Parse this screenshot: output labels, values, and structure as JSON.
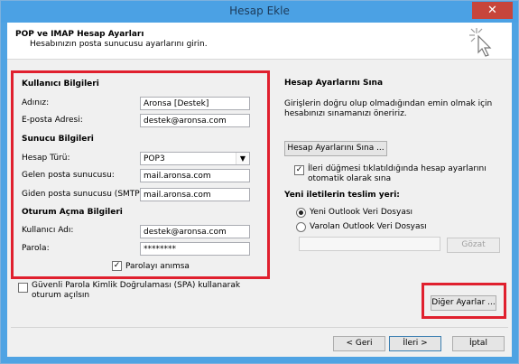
{
  "window": {
    "title": "Hesap Ekle",
    "close_label": "✕"
  },
  "header": {
    "title": "POP ve IMAP Hesap Ayarları",
    "subtitle": "Hesabınızın posta sunucusu ayarlarını girin."
  },
  "user_info": {
    "section": "Kullanıcı Bilgileri",
    "name_label": "Adınız:",
    "name_value": "Aronsa [Destek]",
    "email_label": "E-posta Adresi:",
    "email_value": "destek@aronsa.com"
  },
  "server_info": {
    "section": "Sunucu Bilgileri",
    "type_label": "Hesap Türü:",
    "type_value": "POP3",
    "incoming_label": "Gelen posta sunucusu:",
    "incoming_value": "mail.aronsa.com",
    "outgoing_label": "Giden posta sunucusu (SMTP):",
    "outgoing_value": "mail.aronsa.com"
  },
  "logon_info": {
    "section": "Oturum Açma Bilgileri",
    "username_label": "Kullanıcı Adı:",
    "username_value": "destek@aronsa.com",
    "password_label": "Parola:",
    "password_value": "********",
    "remember_label": "Parolayı anımsa",
    "remember_checked": true
  },
  "spa": {
    "label_line1": "Güvenli Parola Kimlik Doğrulaması (SPA) kullanarak",
    "label_line2": "oturum açılsın",
    "checked": false
  },
  "test": {
    "section": "Hesap Ayarlarını Sına",
    "description_line1": "Girişlerin doğru olup olmadığından emin olmak için",
    "description_line2": "hesabınızı sınamanızı öneririz.",
    "button": "Hesap Ayarlarını Sına ...",
    "auto_label_line1": "İleri düğmesi tıklatıldığında hesap ayarlarını",
    "auto_label_line2": "otomatik olarak sına",
    "auto_checked": true
  },
  "delivery": {
    "section": "Yeni iletilerin teslim yeri:",
    "option_new": "Yeni Outlook Veri Dosyası",
    "option_existing": "Varolan Outlook Veri Dosyası",
    "selected": "new",
    "path_value": "",
    "browse_button": "Gözat"
  },
  "more_settings_button": "Diğer Ayarlar ...",
  "footer": {
    "back": "< Geri",
    "next": "İleri >",
    "cancel": "İptal"
  },
  "colors": {
    "title_bar": "#4ba1e4",
    "highlight": "#e0202e",
    "close_button": "#c7453b"
  }
}
